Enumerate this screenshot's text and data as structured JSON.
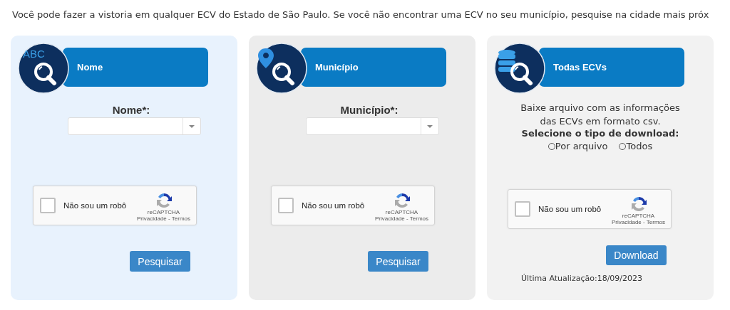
{
  "intro": "Você pode fazer a vistoria em qualquer ECV do Estado de São Paulo. Se você não encontrar uma ECV no seu município, pesquise na cidade mais próx",
  "cards": [
    {
      "kind": "search",
      "icon_text": "ABC",
      "title": "Nome",
      "field_label": "Nome*:",
      "captcha": {
        "label": "Não sou um robô",
        "checked": false,
        "brand": "reCAPTCHA",
        "links": "Privacidade - Termos"
      },
      "button": "Pesquisar"
    },
    {
      "kind": "search",
      "title": "Município",
      "field_label": "Município*:",
      "captcha": {
        "label": "Não sou um robô",
        "checked": false,
        "brand": "reCAPTCHA",
        "links": "Privacidade - Termos"
      },
      "button": "Pesquisar"
    },
    {
      "kind": "download",
      "title": "Todas ECVs",
      "description": "Baixe arquivo com as informações das ECVs em formato csv.",
      "prompt": "Selecione o tipo de download:",
      "options": [
        {
          "label": "Por arquivo",
          "selected": false
        },
        {
          "label": "Todos",
          "selected": false
        }
      ],
      "captcha": {
        "label": "Não sou um robô",
        "checked": false,
        "brand": "reCAPTCHA",
        "links": "Privacidade - Termos"
      },
      "button": "Download",
      "updated": "Última Atualização:18/09/2023"
    }
  ]
}
